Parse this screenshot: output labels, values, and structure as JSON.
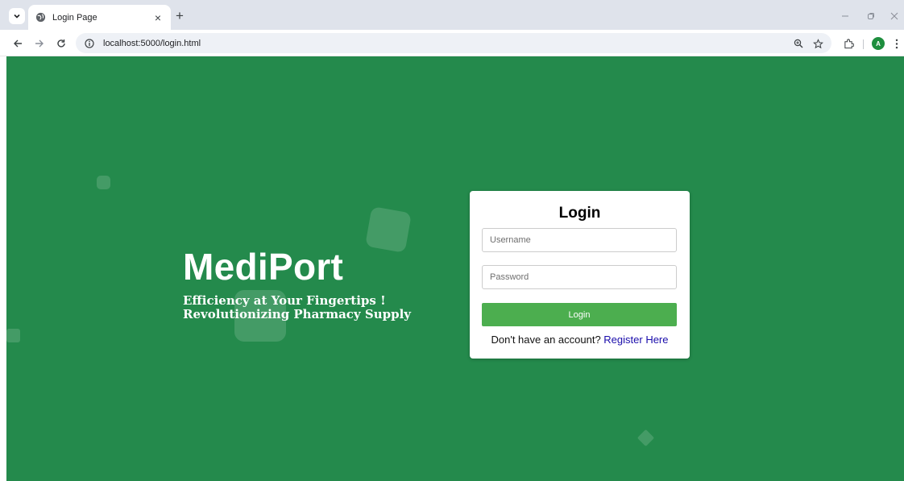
{
  "browser": {
    "tab": {
      "title": "Login Page",
      "close_glyph": "×"
    },
    "new_tab_glyph": "+",
    "url": "localhost:5000/login.html",
    "profile_initial": "A",
    "icons": [
      "tab-search-icon",
      "globe-icon",
      "back-arrow-icon",
      "forward-arrow-icon",
      "reload-icon",
      "site-info-icon",
      "zoom-icon",
      "bookmark-star-icon",
      "extensions-icon",
      "menu-dots-icon",
      "minimize-icon",
      "restore-icon",
      "close-window-icon"
    ]
  },
  "hero": {
    "brand": "MediPort",
    "tagline_line1": "Efficiency at Your Fingertips !",
    "tagline_line2": "Revolutionizing Pharmacy Supply"
  },
  "login": {
    "title": "Login",
    "username_placeholder": "Username",
    "password_placeholder": "Password",
    "button_label": "Login",
    "register_prompt": "Don't have an account?",
    "register_link": "Register Here"
  },
  "colors": {
    "background": "#248a4c",
    "button": "#4cae4f",
    "link": "#1a0dab",
    "card": "#ffffff"
  }
}
